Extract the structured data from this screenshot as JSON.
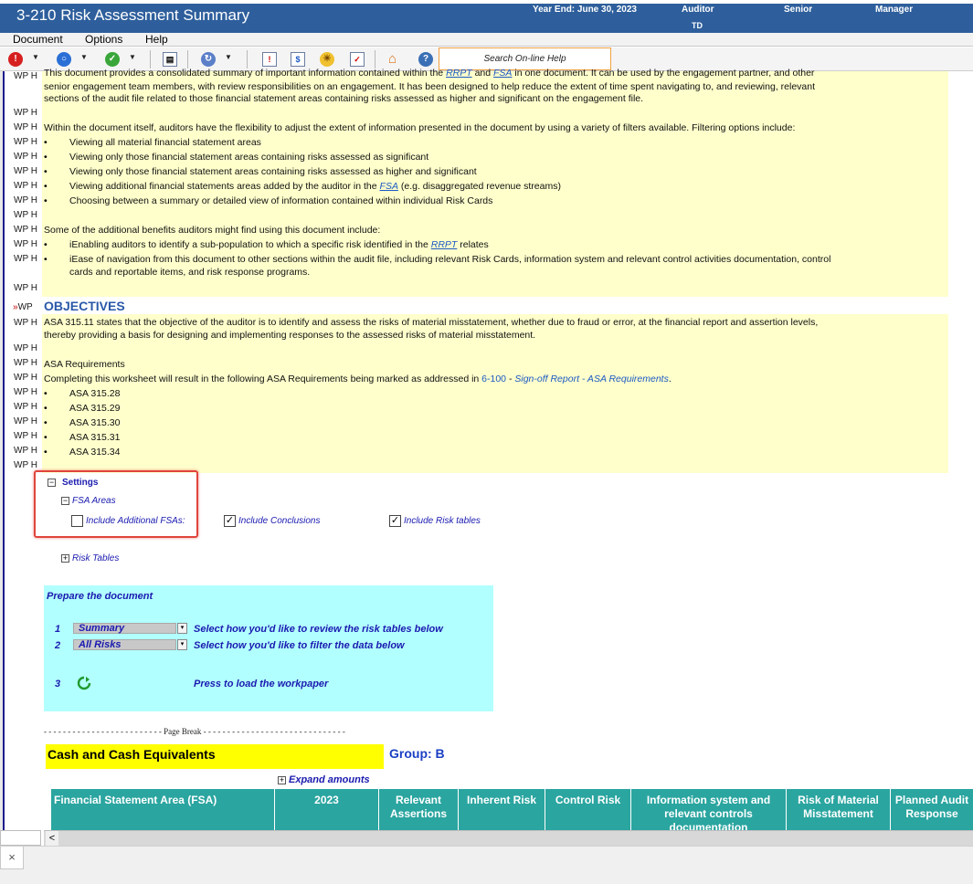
{
  "window": {
    "title": "3-210 Risk Assessment Summary",
    "year_end": "Year End: June 30, 2023",
    "col_auditor": "Auditor",
    "col_senior": "Senior",
    "col_manager": "Manager",
    "auditor_initials": "TD"
  },
  "menu": {
    "document": "Document",
    "options": "Options",
    "help": "Help"
  },
  "toolbar": {
    "search_label": "Search On-line Help",
    "icons": [
      "error-icon",
      "circle-icon",
      "check-icon",
      "ruler-icon",
      "refresh-icon",
      "document-icons",
      "home-icon",
      "help-icon"
    ]
  },
  "gutter": {
    "wp": "WP H",
    "wp_short": "WP",
    "marker": "»"
  },
  "intro": {
    "line1a": "This document provides a consolidated summary of important information contained within the ",
    "rrpt": "RRPT",
    "and": " and ",
    "fsa": "FSA",
    "line1b": " in one document. It can be used by the engagement partner, and other",
    "line2": "senior engagement team members, with review responsibilities on an engagement. It has been designed to help reduce the extent of time spent navigating to, and reviewing, relevant",
    "line3": "sections of the audit file related to those financial statement areas containing risks assessed as higher and significant on the engagement file.",
    "filters_intro": "Within the document itself, auditors have the flexibility to adjust the extent of information presented in the document by using a variety of filters available. Filtering options include:",
    "filter1": "Viewing all material financial statement areas",
    "filter2": "Viewing only those financial statement areas containing risks assessed as significant",
    "filter3": "Viewing only those financial statement areas containing risks assessed as higher and significant",
    "filter4a": "Viewing additional financial statements areas added by the auditor in the ",
    "filter4_link": "FSA",
    "filter4b": " (e.g. disaggregated revenue streams)",
    "filter5": "Choosing between a summary or detailed view of information contained within individual Risk Cards",
    "benefits_intro": "Some of the additional benefits auditors might find using this document include:",
    "benefit1a": "iEnabling auditors to identify a sub-population to which a specific risk identified in the ",
    "benefit1_link": "RRPT",
    "benefit1b": " relates",
    "benefit2a": "iEase of navigation from this document to other sections within the audit file, including relevant Risk Cards, information system and relevant control activities documentation, control",
    "benefit2b": "cards and reportable items, and risk response programs.",
    "bullet": "•"
  },
  "objectives": {
    "heading": "OBJECTIVES",
    "p1": "ASA 315.11 states that the objective of the auditor is to identify and assess the risks of material misstatement, whether due to fraud or error, at the financial report and assertion levels,",
    "p2": "thereby providing a basis for designing and implementing responses to the assessed risks of material misstatement.",
    "req_title": "ASA Requirements",
    "req_text": "Completing this worksheet will result in the following ASA Requirements being marked as addressed in ",
    "req_link1": "6-100",
    "req_dash": " - ",
    "req_link2": "Sign-off Report - ASA Requirements",
    "req_end": ".",
    "items": [
      "ASA 315.28",
      "ASA 315.29",
      "ASA 315.30",
      "ASA 315.31",
      "ASA 315.34"
    ]
  },
  "settings": {
    "title": "Settings",
    "fsa_areas": "FSA Areas",
    "include_additional": "Include Additional FSAs:",
    "include_additional_checked": false,
    "include_conclusions": "Include Conclusions",
    "include_conclusions_checked": true,
    "include_risk_tables": "Include Risk tables",
    "include_risk_tables_checked": true,
    "risk_tables": "Risk Tables",
    "minus": "−",
    "plus": "+",
    "check": "✓"
  },
  "prepare": {
    "title": "Prepare the document",
    "step1_num": "1",
    "step1_value": "Summary",
    "step1_text": "Select how you'd like to review the risk tables below",
    "step2_num": "2",
    "step2_value": "All Risks",
    "step2_text": "Select how you'd like to filter the data below",
    "step3_num": "3",
    "step3_text": "Press to load the workpaper",
    "dd_arrow": "▾"
  },
  "page_break": "- - - - - - - - - - - - - - - - - - - - - - - - -   Page Break   - - - - - - - - - - - - - - - - - - - - - - - - - - - - - -",
  "section": {
    "title": "Cash and Cash Equivalents",
    "group": "Group: B",
    "expand": "Expand amounts"
  },
  "table": {
    "headers": [
      "Financial Statement Area (FSA)",
      "2023",
      "Relevant Assertions",
      "Inherent Risk",
      "Control Risk",
      "Information system and relevant controls documentation",
      "Risk of Material Misstatement",
      "Planned Audit Response"
    ]
  },
  "scroll": {
    "left_arrow": "<"
  },
  "tab": {
    "close": "×"
  }
}
